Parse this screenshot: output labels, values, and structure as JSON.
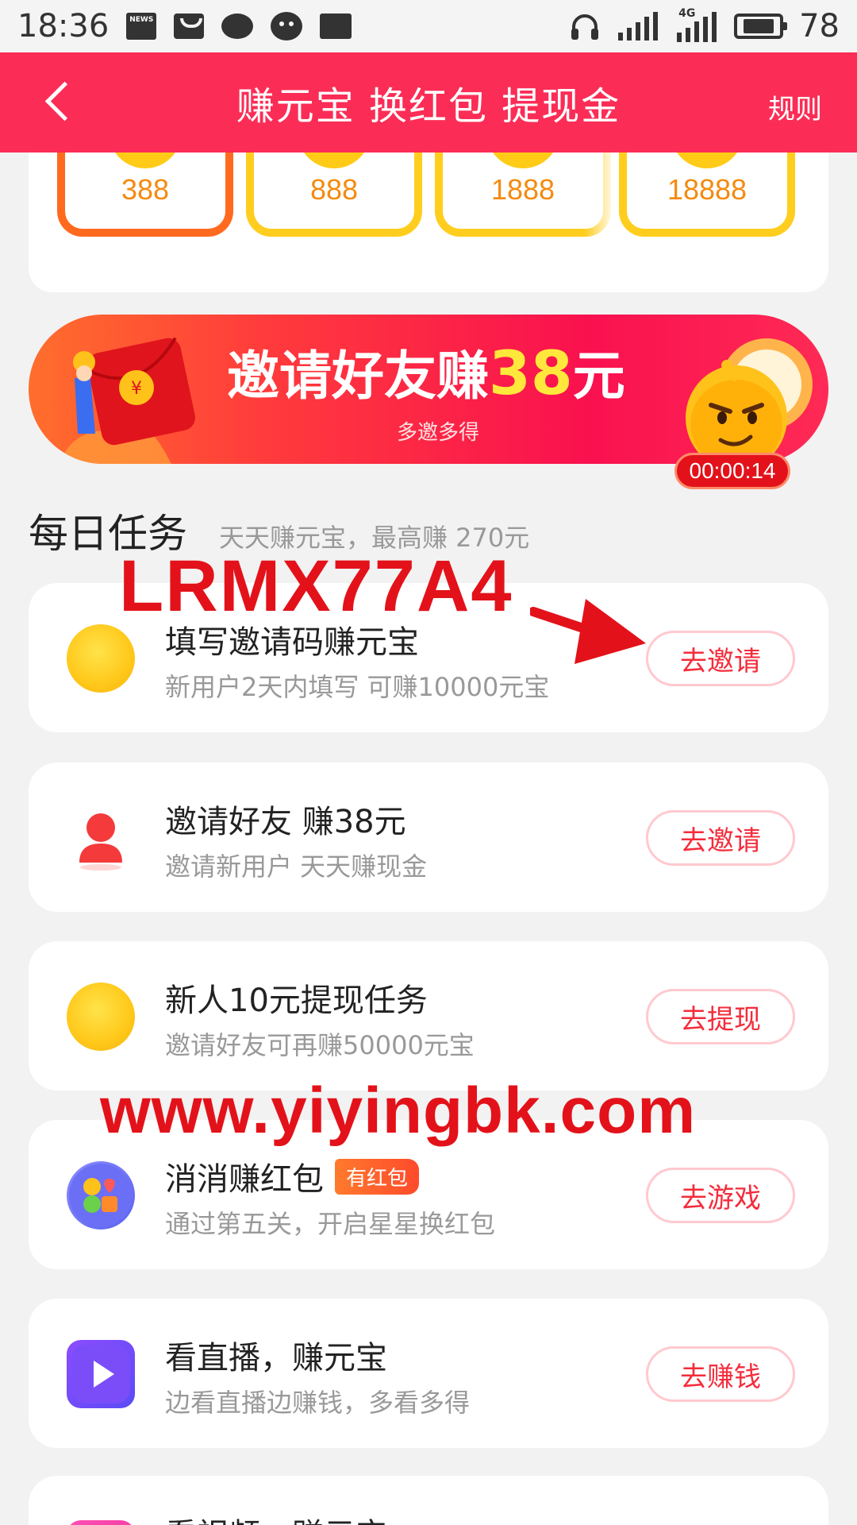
{
  "status_bar": {
    "time": "18:36",
    "news_label": "NEWS",
    "network_label": "4G",
    "battery": "78"
  },
  "header": {
    "title": "赚元宝 换红包 提现金",
    "rules": "规则"
  },
  "tiers": [
    {
      "amount": "388",
      "active": true
    },
    {
      "amount": "888",
      "active": false
    },
    {
      "amount": "1888",
      "active": false
    },
    {
      "amount": "18888",
      "active": false
    }
  ],
  "invite_banner": {
    "headline_prefix": "邀请好友赚",
    "headline_number": "38",
    "headline_suffix": "元",
    "subtitle": "多邀多得",
    "timer": "00:00:14"
  },
  "daily_tasks": {
    "title": "每日任务",
    "subtitle": "天天赚元宝，最高赚 270元",
    "items": [
      {
        "title": "填写邀请码赚元宝",
        "desc": "新用户2天内填写 可赚10000元宝",
        "button": "去邀请",
        "icon": "ingot-coin-icon"
      },
      {
        "title": "邀请好友 赚38元",
        "desc": "邀请新用户 天天赚现金",
        "button": "去邀请",
        "icon": "person-icon"
      },
      {
        "title": "新人10元提现任务",
        "desc": "邀请好友可再赚50000元宝",
        "button": "去提现",
        "icon": "ingot-coin-icon"
      },
      {
        "title": "消消赚红包",
        "badge": "有红包",
        "desc": "通过第五关，开启星星换红包",
        "button": "去游戏",
        "icon": "game-icon"
      },
      {
        "title": "看直播，赚元宝",
        "desc": "边看直播边赚钱，多看多得",
        "button": "去赚钱",
        "icon": "play-icon"
      },
      {
        "title": "看视频，赚元宝",
        "icon": "video-icon"
      }
    ]
  },
  "overlays": {
    "invite_code": "LRMX77A4",
    "website": "www.yiyingbk.com"
  },
  "colors": {
    "header": "#fb2d56",
    "button_text": "#f42c3b",
    "watermark": "#e3121a"
  }
}
